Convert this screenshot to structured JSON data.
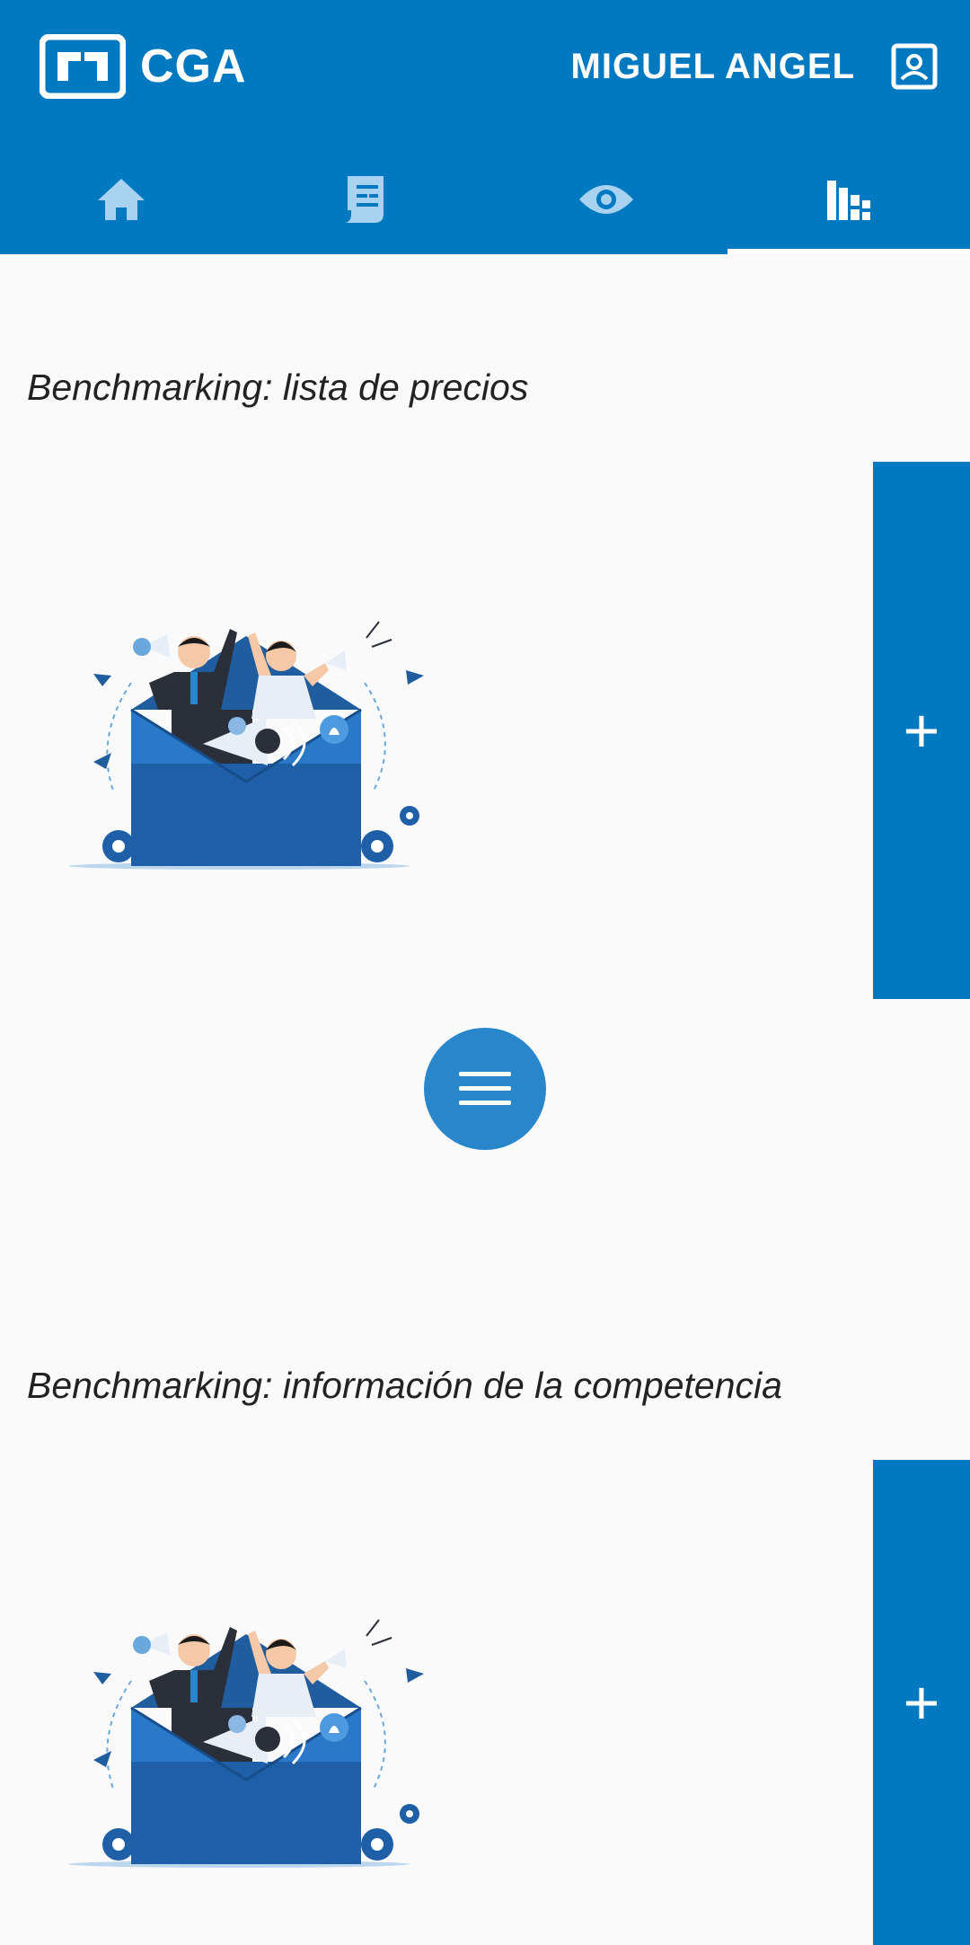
{
  "header": {
    "brand": "CGA",
    "user_name": "MIGUEL ANGEL",
    "accent_color": "#0079c1"
  },
  "tabs": [
    {
      "icon": "home-icon",
      "active": false
    },
    {
      "icon": "receipt-icon",
      "active": false
    },
    {
      "icon": "eye-icon",
      "active": false
    },
    {
      "icon": "bar-chart-icon",
      "active": true
    }
  ],
  "sections": [
    {
      "title": "Benchmarking: lista de precios",
      "add_label": "+"
    },
    {
      "title": "Benchmarking: información de la competencia",
      "add_label": "+"
    }
  ],
  "fab": {
    "icon": "menu-icon"
  }
}
